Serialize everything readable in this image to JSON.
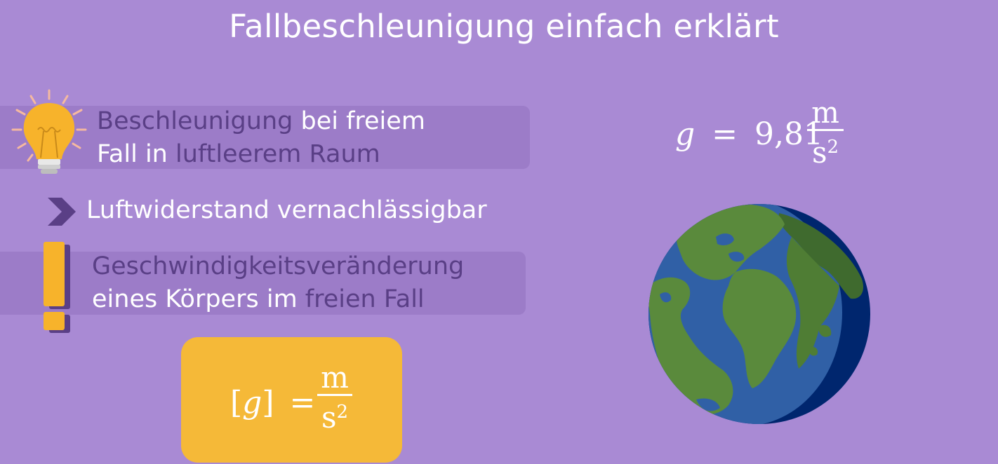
{
  "title": "Fallbeschleunigung einfach erklärt",
  "line1": {
    "a": "Beschleunigung",
    "b": " bei freiem"
  },
  "line2": {
    "a": "Fall in ",
    "b": "luftleerem Raum"
  },
  "line3": "Luftwiderstand vernachlässigbar",
  "line4": "Geschwindigkeitsveränderung",
  "line5": {
    "a": "eines Körpers im ",
    "b": "freien Fall"
  },
  "formula_main": {
    "g": "g",
    "eq": "=",
    "value": "9,81",
    "num": "m",
    "den": "s",
    "exp": "2"
  },
  "formula_unit": {
    "lb": "[",
    "g": "g",
    "rb": "]",
    "eq": "=",
    "num": "m",
    "den": "s",
    "exp": "2"
  },
  "icons": {
    "bulb": "lightbulb-icon",
    "chevron": "chevron-right-icon",
    "exclaim": "exclamation-icon",
    "earth": "earth-globe"
  },
  "colors": {
    "background": "#a98ad4",
    "band": "#9c7cc8",
    "dark_text": "#5a3f86",
    "formula_box": "#f5b938",
    "ocean": "#3060a6",
    "land": "#5a8a3c"
  }
}
